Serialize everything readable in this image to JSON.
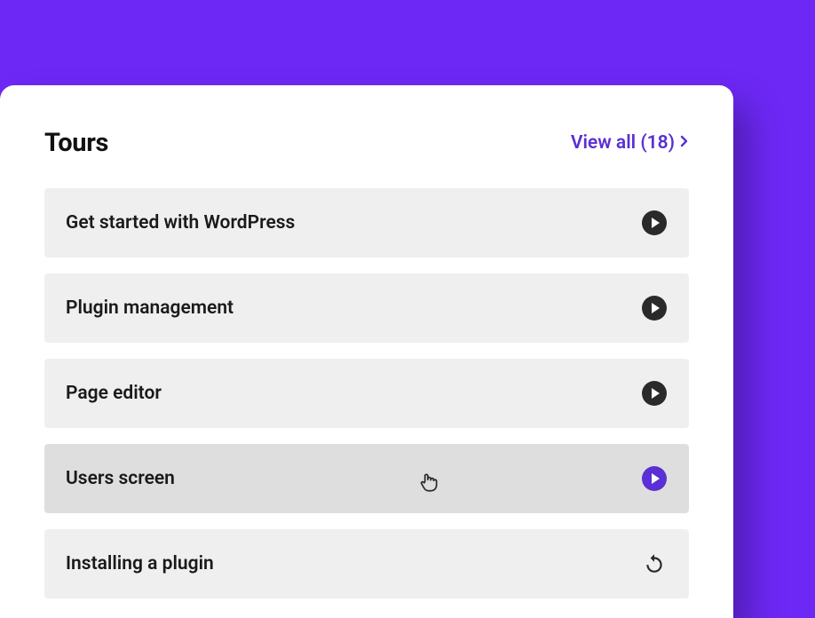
{
  "header": {
    "title": "Tours",
    "view_all_label": "View all (18)",
    "view_all_count": 18
  },
  "colors": {
    "accent": "#5a2fd4",
    "background": "#6d28f5",
    "item_bg": "#efefef",
    "item_hover_bg": "#dedede",
    "icon_dark": "#2a2a2a"
  },
  "tours": [
    {
      "label": "Get started with WordPress",
      "action": "play",
      "hovered": false
    },
    {
      "label": "Plugin management",
      "action": "play",
      "hovered": false
    },
    {
      "label": "Page editor",
      "action": "play",
      "hovered": false
    },
    {
      "label": "Users screen",
      "action": "play",
      "hovered": true
    },
    {
      "label": "Installing a plugin",
      "action": "replay",
      "hovered": false
    }
  ]
}
